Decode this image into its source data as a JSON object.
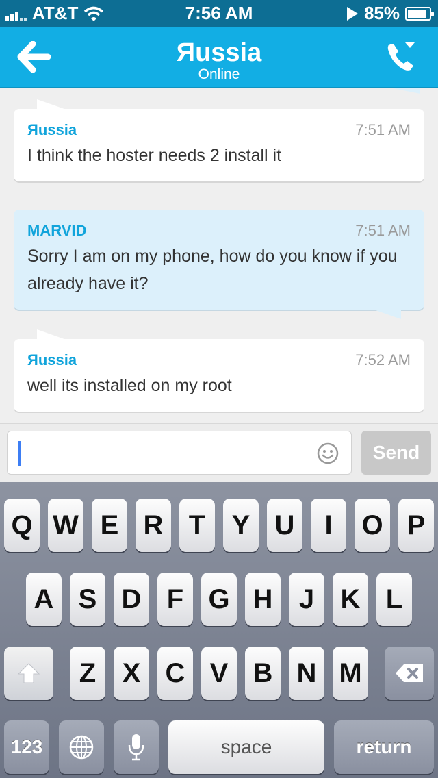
{
  "status_bar": {
    "carrier": "AT&T",
    "time": "7:56 AM",
    "battery_percent": "85%",
    "battery_level": 0.85
  },
  "nav": {
    "title": "Яussia",
    "subtitle": "Online"
  },
  "messages": [
    {
      "sender": "Яussia",
      "time": "7:51 AM",
      "text": "I think the hoster needs 2 install it",
      "self": false
    },
    {
      "sender": "MARVID",
      "time": "7:51 AM",
      "text": "Sorry I am on my phone, how do you know if you already have it?",
      "self": true
    },
    {
      "sender": "Яussia",
      "time": "7:52 AM",
      "text": "well its installed on my root",
      "self": false
    }
  ],
  "input": {
    "value": "",
    "send_label": "Send"
  },
  "keyboard": {
    "row1": [
      "Q",
      "W",
      "E",
      "R",
      "T",
      "Y",
      "U",
      "I",
      "O",
      "P"
    ],
    "row2": [
      "A",
      "S",
      "D",
      "F",
      "G",
      "H",
      "J",
      "K",
      "L"
    ],
    "row3": [
      "Z",
      "X",
      "C",
      "V",
      "B",
      "N",
      "M"
    ],
    "numbers_label": "123",
    "space_label": "space",
    "return_label": "return"
  },
  "colors": {
    "nav_bg": "#12aee4",
    "status_bg": "#0d6e94",
    "sender_color": "#11a4db",
    "self_bubble": "#dcf0fb"
  },
  "icons": [
    "wifi-icon",
    "location-arrow-icon",
    "battery-icon",
    "back-arrow-icon",
    "phone-call-icon",
    "smiley-icon",
    "shift-arrow-icon",
    "globe-icon",
    "microphone-icon",
    "backspace-icon"
  ]
}
